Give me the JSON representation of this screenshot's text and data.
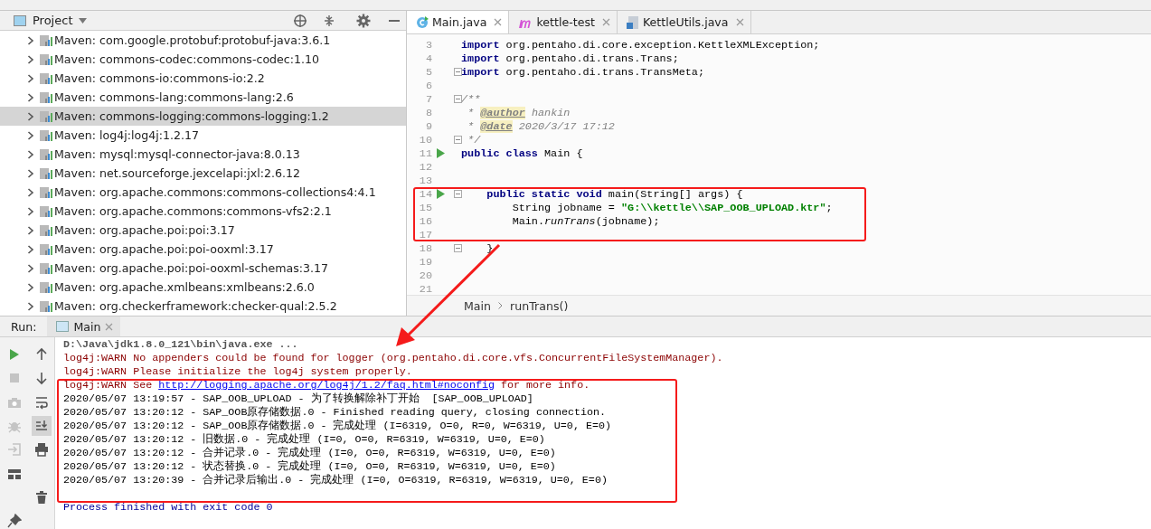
{
  "project": {
    "title": "Project",
    "items": [
      {
        "label": "Maven: com.google.protobuf:protobuf-java:3.6.1",
        "selected": false
      },
      {
        "label": "Maven: commons-codec:commons-codec:1.10",
        "selected": false
      },
      {
        "label": "Maven: commons-io:commons-io:2.2",
        "selected": false
      },
      {
        "label": "Maven: commons-lang:commons-lang:2.6",
        "selected": false
      },
      {
        "label": "Maven: commons-logging:commons-logging:1.2",
        "selected": true
      },
      {
        "label": "Maven: log4j:log4j:1.2.17",
        "selected": false
      },
      {
        "label": "Maven: mysql:mysql-connector-java:8.0.13",
        "selected": false
      },
      {
        "label": "Maven: net.sourceforge.jexcelapi:jxl:2.6.12",
        "selected": false
      },
      {
        "label": "Maven: org.apache.commons:commons-collections4:4.1",
        "selected": false
      },
      {
        "label": "Maven: org.apache.commons:commons-vfs2:2.1",
        "selected": false
      },
      {
        "label": "Maven: org.apache.poi:poi:3.17",
        "selected": false
      },
      {
        "label": "Maven: org.apache.poi:poi-ooxml:3.17",
        "selected": false
      },
      {
        "label": "Maven: org.apache.poi:poi-ooxml-schemas:3.17",
        "selected": false
      },
      {
        "label": "Maven: org.apache.xmlbeans:xmlbeans:2.6.0",
        "selected": false
      },
      {
        "label": "Maven: org.checkerframework:checker-qual:2.5.2",
        "selected": false
      }
    ]
  },
  "editor": {
    "tabs": [
      {
        "label": "Main.java",
        "kind": "class",
        "selected": true
      },
      {
        "label": "kettle-test",
        "kind": "maven",
        "selected": false
      },
      {
        "label": "KettleUtils.java",
        "kind": "file",
        "selected": false
      }
    ],
    "lines": [
      {
        "number": "3",
        "run": false,
        "fold": false,
        "parts": [
          {
            "kind": "keyword",
            "text": "import"
          },
          {
            "kind": "plain",
            "text": " org.pentaho.di.core.exception.KettleXMLException;"
          }
        ]
      },
      {
        "number": "4",
        "run": false,
        "fold": false,
        "parts": [
          {
            "kind": "keyword",
            "text": "import"
          },
          {
            "kind": "plain",
            "text": " org.pentaho.di.trans.Trans;"
          }
        ]
      },
      {
        "number": "5",
        "run": false,
        "fold": true,
        "parts": [
          {
            "kind": "keyword",
            "text": "import"
          },
          {
            "kind": "plain",
            "text": " org.pentaho.di.trans.TransMeta;"
          }
        ]
      },
      {
        "number": "6",
        "run": false,
        "fold": false
      },
      {
        "number": "7",
        "run": false,
        "fold": true,
        "parts": [
          {
            "kind": "comment",
            "text": "/**"
          }
        ]
      },
      {
        "number": "8",
        "run": false,
        "fold": false,
        "parts": [
          {
            "kind": "comment",
            "text": " * "
          },
          {
            "kind": "tag",
            "text": "@author"
          },
          {
            "kind": "comment",
            "text": " hankin"
          }
        ]
      },
      {
        "number": "9",
        "run": false,
        "fold": false,
        "parts": [
          {
            "kind": "comment",
            "text": " * "
          },
          {
            "kind": "tag",
            "text": "@date"
          },
          {
            "kind": "comment",
            "text": " 2020/3/17 17:12"
          }
        ]
      },
      {
        "number": "10",
        "run": false,
        "fold": true,
        "parts": [
          {
            "kind": "comment",
            "text": " */"
          }
        ]
      },
      {
        "number": "11",
        "run": true,
        "fold": false,
        "parts": [
          {
            "kind": "keyword",
            "text": "public class"
          },
          {
            "kind": "plain",
            "text": " Main {"
          }
        ]
      },
      {
        "number": "12",
        "run": false,
        "fold": false
      },
      {
        "number": "13",
        "run": false,
        "fold": false
      },
      {
        "number": "14",
        "run": true,
        "fold": true,
        "parts": [
          {
            "kind": "keyword",
            "text": "    public static void"
          },
          {
            "kind": "plain",
            "text": " main(String[] args) {"
          }
        ]
      },
      {
        "number": "15",
        "run": false,
        "fold": false,
        "parts": [
          {
            "kind": "plain",
            "text": "        String jobname = "
          },
          {
            "kind": "string",
            "text": "\"G:\\\\kettle\\\\SAP_OOB_UPLOAD.ktr\""
          },
          {
            "kind": "plain",
            "text": ";"
          }
        ]
      },
      {
        "number": "16",
        "run": false,
        "fold": false,
        "parts": [
          {
            "kind": "plain",
            "text": "        Main."
          },
          {
            "kind": "italic",
            "text": "runTrans"
          },
          {
            "kind": "plain",
            "text": "(jobname);"
          }
        ]
      },
      {
        "number": "17",
        "run": false,
        "fold": false
      },
      {
        "number": "18",
        "run": false,
        "fold": true,
        "parts": [
          {
            "kind": "plain",
            "text": "    }"
          }
        ]
      },
      {
        "number": "19",
        "run": false,
        "fold": false
      },
      {
        "number": "20",
        "run": false,
        "fold": false
      },
      {
        "number": "21",
        "run": false,
        "fold": false
      }
    ],
    "breadcrumbs": [
      "Main",
      "runTrans()"
    ]
  },
  "run": {
    "label": "Run:",
    "tab": "Main",
    "console": [
      {
        "parts": [
          {
            "kind": "command",
            "text": "D:\\Java\\jdk1.8.0_121\\bin\\java.exe ..."
          }
        ]
      },
      {
        "parts": [
          {
            "kind": "warn",
            "text": "log4j:WARN No appenders could be found for logger (org.pentaho.di.core.vfs.ConcurrentFileSystemManager)."
          }
        ]
      },
      {
        "parts": [
          {
            "kind": "warn",
            "text": "log4j:WARN Please initialize the log4j system properly."
          }
        ]
      },
      {
        "parts": [
          {
            "kind": "warn",
            "text": "log4j:WARN See "
          },
          {
            "kind": "link",
            "text": "http://logging.apache.org/log4j/1.2/faq.html#noconfig"
          },
          {
            "kind": "warn",
            "text": " for more info."
          }
        ]
      },
      {
        "parts": [
          {
            "kind": "info",
            "text": "2020/05/07 13:19:57 - SAP_OOB_UPLOAD - 为了转换解除补丁开始  [SAP_OOB_UPLOAD]"
          }
        ]
      },
      {
        "parts": [
          {
            "kind": "info",
            "text": "2020/05/07 13:20:12 - SAP_OOB原存储数据.0 - Finished reading query, closing connection."
          }
        ]
      },
      {
        "parts": [
          {
            "kind": "info",
            "text": "2020/05/07 13:20:12 - SAP_OOB原存储数据.0 - 完成处理 (I=6319, O=0, R=0, W=6319, U=0, E=0)"
          }
        ]
      },
      {
        "parts": [
          {
            "kind": "info",
            "text": "2020/05/07 13:20:12 - 旧数据.0 - 完成处理 (I=0, O=0, R=6319, W=6319, U=0, E=0)"
          }
        ]
      },
      {
        "parts": [
          {
            "kind": "info",
            "text": "2020/05/07 13:20:12 - 合并记录.0 - 完成处理 (I=0, O=0, R=6319, W=6319, U=0, E=0)"
          }
        ]
      },
      {
        "parts": [
          {
            "kind": "info",
            "text": "2020/05/07 13:20:12 - 状态替换.0 - 完成处理 (I=0, O=0, R=6319, W=6319, U=0, E=0)"
          }
        ]
      },
      {
        "parts": [
          {
            "kind": "info",
            "text": "2020/05/07 13:20:39 - 合并记录后输出.0 - 完成处理 (I=0, O=6319, R=6319, W=6319, U=0, E=0)"
          }
        ]
      },
      {
        "parts": [
          {
            "kind": "exit",
            "text": "Process finished with exit code 0"
          }
        ]
      }
    ]
  }
}
